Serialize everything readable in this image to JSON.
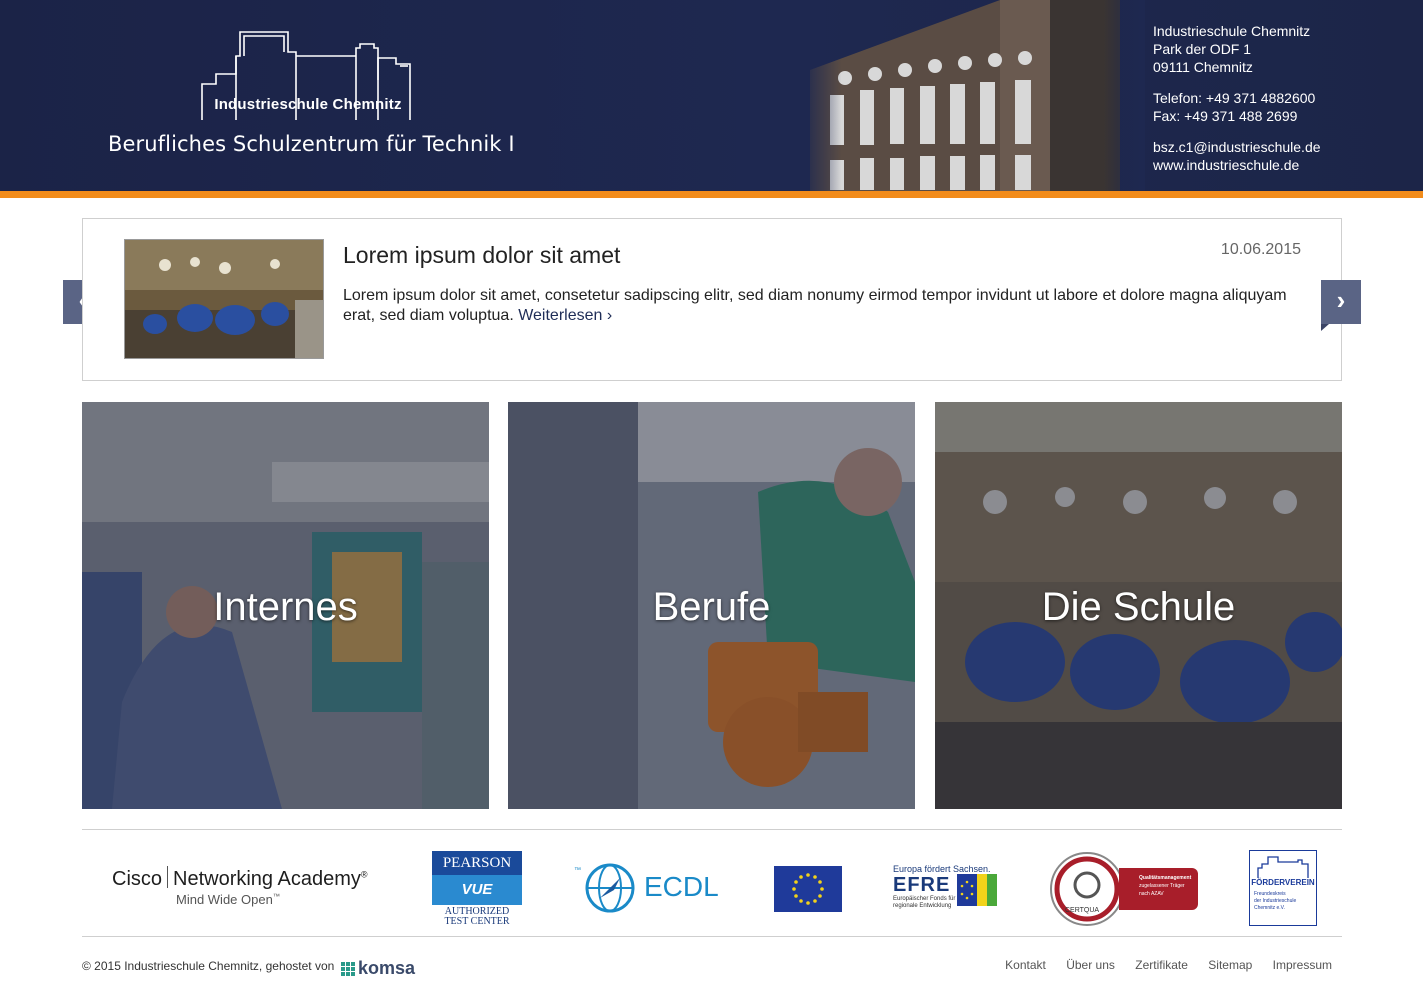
{
  "header": {
    "logo_name": "Industrieschule Chemnitz",
    "subtitle": "Berufliches Schulzentrum für Technik I",
    "contact": {
      "line1": "Industrieschule Chemnitz",
      "line2": "Park der ODF 1",
      "line3": "09111 Chemnitz",
      "phone": "Telefon: +49 371 4882600",
      "fax": "Fax: +49 371 488 2699",
      "email": "bsz.c1@industrieschule.de",
      "web": "www.industrieschule.de"
    }
  },
  "news": {
    "title": "Lorem ipsum dolor sit amet",
    "date": "10.06.2015",
    "text": "Lorem ipsum dolor sit amet, consetetur sadipscing elitr, sed diam nonumy eirmod tempor invidunt ut labore et dolore magna aliquyam erat, sed diam voluptua.",
    "read_more": "Weiterlesen ›",
    "prev_icon": "‹",
    "next_icon": "›"
  },
  "tiles": [
    {
      "label": "Internes"
    },
    {
      "label": "Berufe"
    },
    {
      "label": "Die Schule"
    }
  ],
  "partners": {
    "cisco_left": "Cisco",
    "cisco_right": "Networking Academy",
    "cisco_mark": "®",
    "cisco_sub": "Mind Wide Open",
    "cisco_sub_mark": "™",
    "pearson_top": "PEARSON",
    "pearson_mid": "VUE",
    "pearson_bottom1": "AUTHORIZED",
    "pearson_bottom2": "TEST CENTER",
    "ecdl_tm": "™",
    "ecdl": "ECDL",
    "efre_top": "Europa fördert Sachsen.",
    "efre_main": "EFRE",
    "efre_sub1": "Europäischer Fonds für",
    "efre_sub2": "regionale Entwicklung",
    "certqua_name": "CERTQUA",
    "certqua_line1": "Qualitätsmanagement",
    "certqua_line2": "zugelassener Träger",
    "certqua_line3": "nach AZAV",
    "foerder_title": "FÖRDERVEREIN",
    "foerder_sub1": "Freundeskreis",
    "foerder_sub2": "der Industrieschule",
    "foerder_sub3": "Chemnitz e.V."
  },
  "footer": {
    "copyright": "© 2015 Industrieschule Chemnitz, gehostet von",
    "host": "komsa",
    "links": [
      "Kontakt",
      "Über uns",
      "Zertifikate",
      "Sitemap",
      "Impressum"
    ]
  },
  "colors": {
    "header_bg": "#1e2850",
    "accent_orange": "#f28c1b",
    "arrow_bg": "#5a6485",
    "link": "#1f2d57"
  }
}
